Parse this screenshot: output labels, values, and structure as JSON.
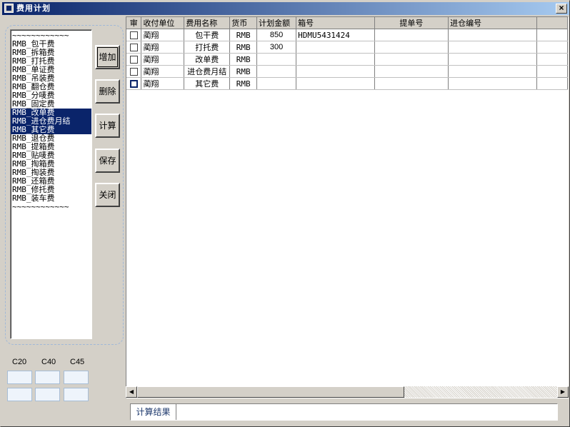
{
  "window": {
    "title": "费用计划",
    "close_glyph": "×"
  },
  "fee_list": {
    "items": [
      {
        "label": "~~~~~~~~~~~~",
        "selected": false
      },
      {
        "label": "RMB_包干费",
        "selected": false
      },
      {
        "label": "RMB_拆箱费",
        "selected": false
      },
      {
        "label": "RMB_打托费",
        "selected": false
      },
      {
        "label": "RMB_单证费",
        "selected": false
      },
      {
        "label": "RMB_吊装费",
        "selected": false
      },
      {
        "label": "RMB_翻仓费",
        "selected": false
      },
      {
        "label": "RMB_分唛费",
        "selected": false
      },
      {
        "label": "RMB_固定费",
        "selected": false
      },
      {
        "label": "RMB_改单费",
        "selected": true
      },
      {
        "label": "RMB_进仓费月结",
        "selected": true
      },
      {
        "label": "RMB_其它费",
        "selected": true
      },
      {
        "label": "RMB_退仓费",
        "selected": false
      },
      {
        "label": "RMB_提箱费",
        "selected": false
      },
      {
        "label": "RMB_贴唛费",
        "selected": false
      },
      {
        "label": "RMB_掏箱费",
        "selected": false
      },
      {
        "label": "RMB_掏装费",
        "selected": false
      },
      {
        "label": "RMB_还箱费",
        "selected": false
      },
      {
        "label": "RMB_修托费",
        "selected": false
      },
      {
        "label": "RMB_装车费",
        "selected": false
      },
      {
        "label": "~~~~~~~~~~~~",
        "selected": false
      }
    ]
  },
  "buttons": {
    "add": "增加",
    "delete": "删除",
    "calculate": "计算",
    "save": "保存",
    "close": "关闭"
  },
  "containers": {
    "labels": [
      "C20",
      "C40",
      "C45"
    ]
  },
  "grid": {
    "columns": [
      "审",
      "收付单位",
      "费用名称",
      "货币",
      "计划金额",
      "箱号",
      "提单号",
      "进仓编号",
      ""
    ],
    "rows": [
      {
        "unit": "蔺翔",
        "fee": "包干费",
        "currency": "RMB",
        "amount": "850",
        "box": "HDMU5431424",
        "bl": "",
        "in_no": ""
      },
      {
        "unit": "蔺翔",
        "fee": "打托费",
        "currency": "RMB",
        "amount": "300",
        "box": "",
        "bl": "",
        "in_no": ""
      },
      {
        "unit": "蔺翔",
        "fee": "改单费",
        "currency": "RMB",
        "amount": "",
        "box": "",
        "bl": "",
        "in_no": ""
      },
      {
        "unit": "蔺翔",
        "fee": "进仓费月结",
        "currency": "RMB",
        "amount": "",
        "box": "",
        "bl": "",
        "in_no": ""
      },
      {
        "unit": "蔺翔",
        "fee": "其它费",
        "currency": "RMB",
        "amount": "",
        "box": "",
        "bl": "",
        "in_no": ""
      }
    ]
  },
  "scrollbar": {
    "left_glyph": "◀",
    "right_glyph": "▶"
  },
  "result": {
    "label": "计算结果",
    "value": ""
  }
}
